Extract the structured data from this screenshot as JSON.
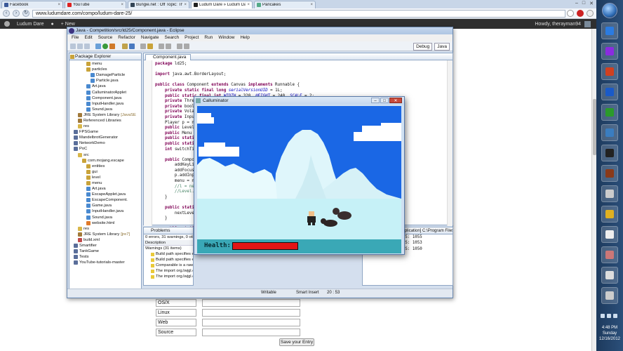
{
  "browser": {
    "tabs": [
      {
        "label": "Facebook",
        "color": "#3b5998"
      },
      {
        "label": "YouTube",
        "color": "#d22"
      },
      {
        "label": "Bungie.net : Off Topic: Th",
        "color": "#345"
      },
      {
        "label": "Ludum Dare » Ludum Da",
        "color": "#222"
      },
      {
        "label": "Pancakes",
        "color": "#5a8"
      }
    ],
    "url": "www.ludumdare.com/compo/ludum-dare-25/",
    "wpbar": {
      "site": "Ludum Dare",
      "new": "+ New",
      "howdy": "Howdy, therayman94"
    }
  },
  "form": {
    "rows": [
      {
        "label": "OS/X"
      },
      {
        "label": "Linux"
      },
      {
        "label": "Web"
      },
      {
        "label": "Source"
      }
    ],
    "submit": "Save your Entry"
  },
  "eclipse": {
    "title": "Java - Competition/src/ld25/Component.java - Eclipse",
    "menu": [
      "File",
      "Edit",
      "Source",
      "Refactor",
      "Navigate",
      "Search",
      "Project",
      "Run",
      "Window",
      "Help"
    ],
    "perspectives": [
      "Debug",
      "Java"
    ],
    "package_explorer": {
      "title": "Package Explorer",
      "tree": [
        {
          "label": "menu",
          "indent": 4,
          "icon": "package",
          "sub": ""
        },
        {
          "label": "particles",
          "indent": 4,
          "icon": "package",
          "sub": ""
        },
        {
          "label": "DamageParticle",
          "indent": 5,
          "icon": "java",
          "sub": ""
        },
        {
          "label": "Particle.java",
          "indent": 5,
          "icon": "java",
          "sub": ""
        },
        {
          "label": "Art.java",
          "indent": 4,
          "icon": "java",
          "sub": ""
        },
        {
          "label": "CalluminatorApplet",
          "indent": 4,
          "icon": "java",
          "sub": ""
        },
        {
          "label": "Component.java",
          "indent": 4,
          "icon": "java",
          "sub": ""
        },
        {
          "label": "InputHandler.java",
          "indent": 4,
          "icon": "java",
          "sub": ""
        },
        {
          "label": "Sound.java",
          "indent": 4,
          "icon": "java",
          "sub": ""
        },
        {
          "label": "JRE System Library",
          "indent": 2,
          "icon": "lib",
          "sub": "[JavaSE"
        },
        {
          "label": "Referenced Libraries",
          "indent": 2,
          "icon": "lib",
          "sub": ""
        },
        {
          "label": "res",
          "indent": 2,
          "icon": "folder",
          "sub": ""
        },
        {
          "label": "FPSGame",
          "indent": 1,
          "icon": "project",
          "sub": ""
        },
        {
          "label": "MandelbrotGenerator",
          "indent": 1,
          "icon": "project",
          "sub": ""
        },
        {
          "label": "NetworkDemo",
          "indent": 1,
          "icon": "project",
          "sub": ""
        },
        {
          "label": "PoC",
          "indent": 1,
          "icon": "project",
          "sub": ""
        },
        {
          "label": "src",
          "indent": 2,
          "icon": "folder",
          "sub": ""
        },
        {
          "label": "com.mojang.escape",
          "indent": 3,
          "icon": "package",
          "sub": ""
        },
        {
          "label": "entities",
          "indent": 4,
          "icon": "package",
          "sub": ""
        },
        {
          "label": "gui",
          "indent": 4,
          "icon": "package",
          "sub": ""
        },
        {
          "label": "level",
          "indent": 4,
          "icon": "package",
          "sub": ""
        },
        {
          "label": "menu",
          "indent": 4,
          "icon": "package",
          "sub": ""
        },
        {
          "label": "Art.java",
          "indent": 4,
          "icon": "java",
          "sub": ""
        },
        {
          "label": "EscapeApplet.java",
          "indent": 4,
          "icon": "java",
          "sub": ""
        },
        {
          "label": "EscapeComponent.",
          "indent": 4,
          "icon": "java",
          "sub": ""
        },
        {
          "label": "Game.java",
          "indent": 4,
          "icon": "java",
          "sub": ""
        },
        {
          "label": "InputHandler.java",
          "indent": 4,
          "icon": "java",
          "sub": ""
        },
        {
          "label": "Sound.java",
          "indent": 4,
          "icon": "java",
          "sub": ""
        },
        {
          "label": "website.html",
          "indent": 4,
          "icon": "html",
          "sub": ""
        },
        {
          "label": "res",
          "indent": 2,
          "icon": "folder",
          "sub": ""
        },
        {
          "label": "JRE System Library",
          "indent": 2,
          "icon": "lib",
          "sub": "[jre7]"
        },
        {
          "label": "build.xml",
          "indent": 2,
          "icon": "xml",
          "sub": ""
        },
        {
          "label": "Smartifier",
          "indent": 1,
          "icon": "project",
          "sub": ""
        },
        {
          "label": "TankGame",
          "indent": 1,
          "icon": "project",
          "sub": ""
        },
        {
          "label": "Tests",
          "indent": 1,
          "icon": "project",
          "sub": ""
        },
        {
          "label": "YouTube-tutorials-master",
          "indent": 1,
          "icon": "project",
          "sub": ""
        }
      ]
    },
    "editor": {
      "tab": "Component.java",
      "lines": [
        "package ld25;",
        "",
        "import java.awt.BorderLayout;",
        "",
        "public class Component extends Canvas implements Runnable {",
        "    private static final long serialVersionUID = 1L;",
        "    public static final int WIDTH = 320, HEIGHT = 240, SCALE = 2;",
        "    private Thread",
        "    private boole",
        "    private Volat",
        "    private Input",
        "    Player p = ne",
        "    public Level",
        "    public Menu m",
        "    public static",
        "    public static",
        "    int switchTim",
        "",
        "    public Compone",
        "        addKeyLis",
        "        addFocusL",
        "        p.addInpu",
        "        menu = ne",
        "        //l = new",
        "        //Level.",
        "    }",
        "",
        "    public static",
        "        nextLevel",
        "    }",
        "",
        "    public static"
      ]
    },
    "problems": {
      "tab": "Problems",
      "summary": "0 errors, 31 warnings, 0 others",
      "col": "Description",
      "group": "Warnings (31 items)",
      "items": [
        "Build path specifies execution environment J2SE-1.5. There are no JREs installed in the workspace that are strictly compatible with this environment. Competition",
        "Build path specifies execution environment J2SE-1.5. Tests",
        "Comparable is a raw type. References to generic type Comparable<T> should be parameterized   Entity.java   /Compe",
        "The import org.lwjgl.opengl.GL11 is never used   TerrainDemo...   /YouTub",
        "The import org.lwjgl.opengl.GL11 is never used   TerrainDemo...   /YouTub"
      ]
    },
    "console": {
      "header": "Component [Java Application] C:\\Program Files\\Java\\jre7\\bin\\javaw.exe (Dec 16, 201",
      "lines": [
        "Updates: 60, FPS: 1055",
        "Updates: 60, FPS: 1053",
        "Updates: 60, FPS: 1050"
      ]
    },
    "status": {
      "mode": "Writable",
      "insert": "Smart Insert",
      "pos": "20 : 53"
    }
  },
  "game": {
    "title": "Calluminator",
    "hud_label": "Health:",
    "health": 1.0,
    "colors": {
      "sky": "#1a67e5",
      "ice": "#dff6fb",
      "sea": "#c6f1f7",
      "hud": "#3aa8b6",
      "health": "#e21515"
    }
  },
  "taskbar": {
    "apps": [
      {
        "color": "#2b7be0"
      },
      {
        "color": "#8b2be0"
      },
      {
        "color": "#d04020"
      },
      {
        "color": "#1a5ac8"
      },
      {
        "color": "#2b9a2b"
      },
      {
        "color": "#3a7dc0"
      },
      {
        "color": "#222"
      },
      {
        "color": "#8a3a1a"
      },
      {
        "color": "#ccc"
      },
      {
        "color": "#e0b020"
      },
      {
        "color": "#eee"
      },
      {
        "color": "#c77"
      },
      {
        "color": "#ddd"
      },
      {
        "color": "#ccc"
      }
    ],
    "time": "4:48 PM",
    "day": "Sunday",
    "date": "12/16/2012"
  }
}
